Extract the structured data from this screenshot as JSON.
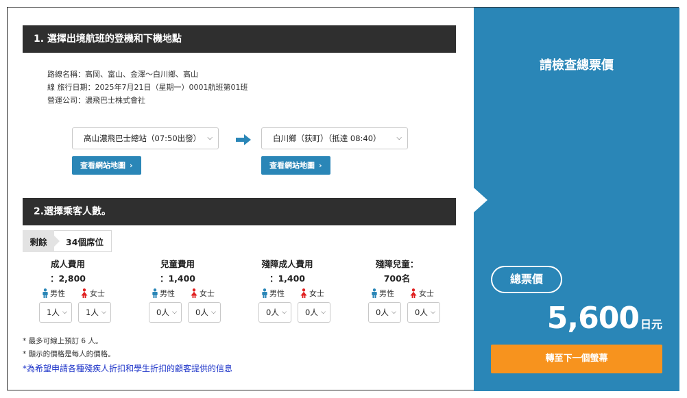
{
  "section1": {
    "title": "1. 選擇出境航班的登機和下機地點",
    "route_info": [
      "路線名稱：高岡、富山、金澤〜白川鄉、高山",
      "線 旅行日期：2025年7月21日（星期一）0001航班第01班",
      "營運公司：濃飛巴士株式會社"
    ],
    "departure": {
      "value": "高山濃飛巴士總站（07:50出發）"
    },
    "arrival": {
      "value": "白川鄉（荻町）（抵達 08:40）"
    },
    "map_button_label": "查看網站地圖",
    "icons": {
      "arrow": "arrow-right-icon",
      "chevron": "chevron-down-icon",
      "map_chevron": "chevron-right-icon"
    }
  },
  "section2": {
    "title": "2.選擇乘客人數。",
    "seats": {
      "label": "剩餘",
      "value": "34個席位"
    },
    "male_label": "男性",
    "female_label": "女士",
    "fares": [
      {
        "line1": "成人費用",
        "line2": "：2,800",
        "male": "1人",
        "female": "1人"
      },
      {
        "line1": "兒童費用",
        "line2": "：1,400",
        "male": "0人",
        "female": "0人"
      },
      {
        "line1": "殘障成人費用",
        "line2": "：1,400",
        "male": "0人",
        "female": "0人"
      },
      {
        "line1": "殘障兒童：",
        "line2": "700名",
        "male": "0人",
        "female": "0人"
      }
    ],
    "notes": [
      "*  最多可線上預訂 6 人。",
      "*  顯示的價格是每人的價格。"
    ],
    "discount_link": "*為希望申請各種殘疾人折扣和學生折扣的顧客提供的信息",
    "colors": {
      "male": "#2a86b7",
      "female": "#e02020"
    }
  },
  "summary": {
    "title": "請檢查總票價",
    "total_label": "總票價",
    "total_amount": "5,600",
    "currency": "日元",
    "next_button": "轉至下一個螢幕",
    "colors": {
      "panel": "#2a86b7",
      "next_button": "#f7931e"
    }
  }
}
